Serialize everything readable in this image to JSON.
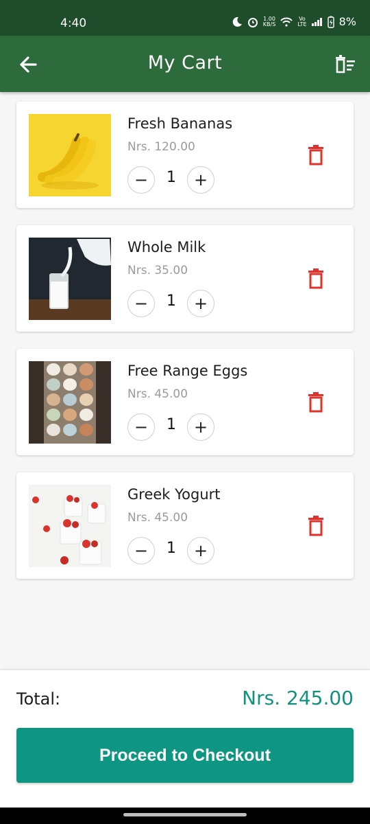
{
  "status_bar": {
    "time": "4:40",
    "net_speed_top": "1.00",
    "net_speed_bottom": "KB/S",
    "volte_top": "Vo",
    "volte_bottom": "LTE",
    "battery": "8%"
  },
  "app_bar": {
    "title": "My Cart",
    "back_icon": "arrow-left-icon",
    "clear_icon": "clear-cart-icon",
    "background": "#2e6b3c"
  },
  "cart_items": [
    {
      "name": "Fresh Bananas",
      "price": "Nrs. 120.00",
      "quantity": "1",
      "minus": "−",
      "plus": "+"
    },
    {
      "name": "Whole Milk",
      "price": "Nrs. 35.00",
      "quantity": "1",
      "minus": "−",
      "plus": "+"
    },
    {
      "name": "Free Range Eggs",
      "price": "Nrs. 45.00",
      "quantity": "1",
      "minus": "−",
      "plus": "+"
    },
    {
      "name": "Greek Yogurt",
      "price": "Nrs. 45.00",
      "quantity": "1",
      "minus": "−",
      "plus": "+"
    }
  ],
  "footer": {
    "total_label": "Total:",
    "total_value": "Nrs. 245.00",
    "checkout_label": "Proceed to Checkout"
  },
  "colors": {
    "accent": "#0f9683",
    "delete": "#e0322c",
    "price_text": "#9a9a9a"
  }
}
